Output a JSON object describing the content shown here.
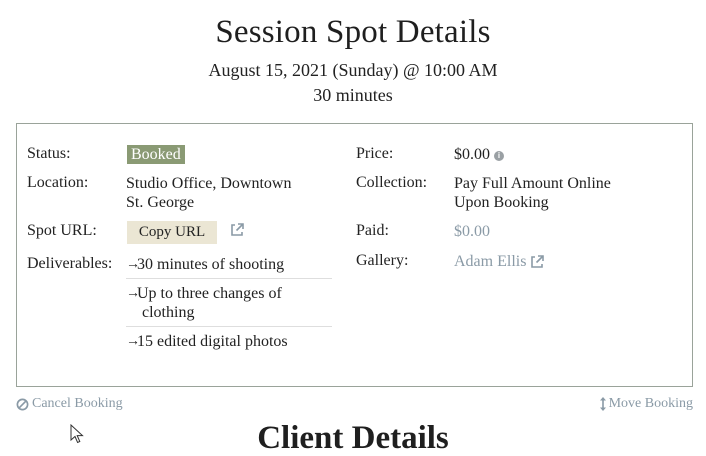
{
  "header": {
    "title": "Session Spot Details",
    "date_line": "August 15, 2021 (Sunday) @ 10:00 AM",
    "duration": "30 minutes"
  },
  "details": {
    "status_label": "Status:",
    "status_value": "Booked",
    "location_label": "Location:",
    "location_line1": "Studio Office, Downtown",
    "location_line2": "St. George",
    "spot_url_label": "Spot URL:",
    "copy_url_label": "Copy URL",
    "deliverables_label": "Deliverables:",
    "deliverables": [
      {
        "arrow": "→",
        "line1": "30 minutes of shooting",
        "line2": ""
      },
      {
        "arrow": "→",
        "line1": "Up to three changes of",
        "line2": "clothing"
      },
      {
        "arrow": "→",
        "line1": "15 edited digital photos",
        "line2": ""
      }
    ],
    "price_label": "Price:",
    "price_value": "$0.00",
    "collection_label": "Collection:",
    "collection_line1": "Pay Full Amount Online",
    "collection_line2": "Upon Booking",
    "paid_label": "Paid:",
    "paid_value": "$0.00",
    "gallery_label": "Gallery:",
    "gallery_value": "Adam Ellis"
  },
  "actions": {
    "cancel_label": "Cancel Booking",
    "move_label": "Move Booking"
  },
  "client_section": {
    "title": "Client Details"
  },
  "icons": {
    "info": "info-icon",
    "external_link": "external-link-icon",
    "cancel": "ban-icon",
    "move": "vertical-arrows-icon",
    "cursor": "mouse-pointer-icon"
  },
  "colors": {
    "badge_bg": "#8a9a74",
    "link_muted": "#8a9aa6",
    "button_bg": "#ebe6d4",
    "box_border": "#9aa39a"
  }
}
